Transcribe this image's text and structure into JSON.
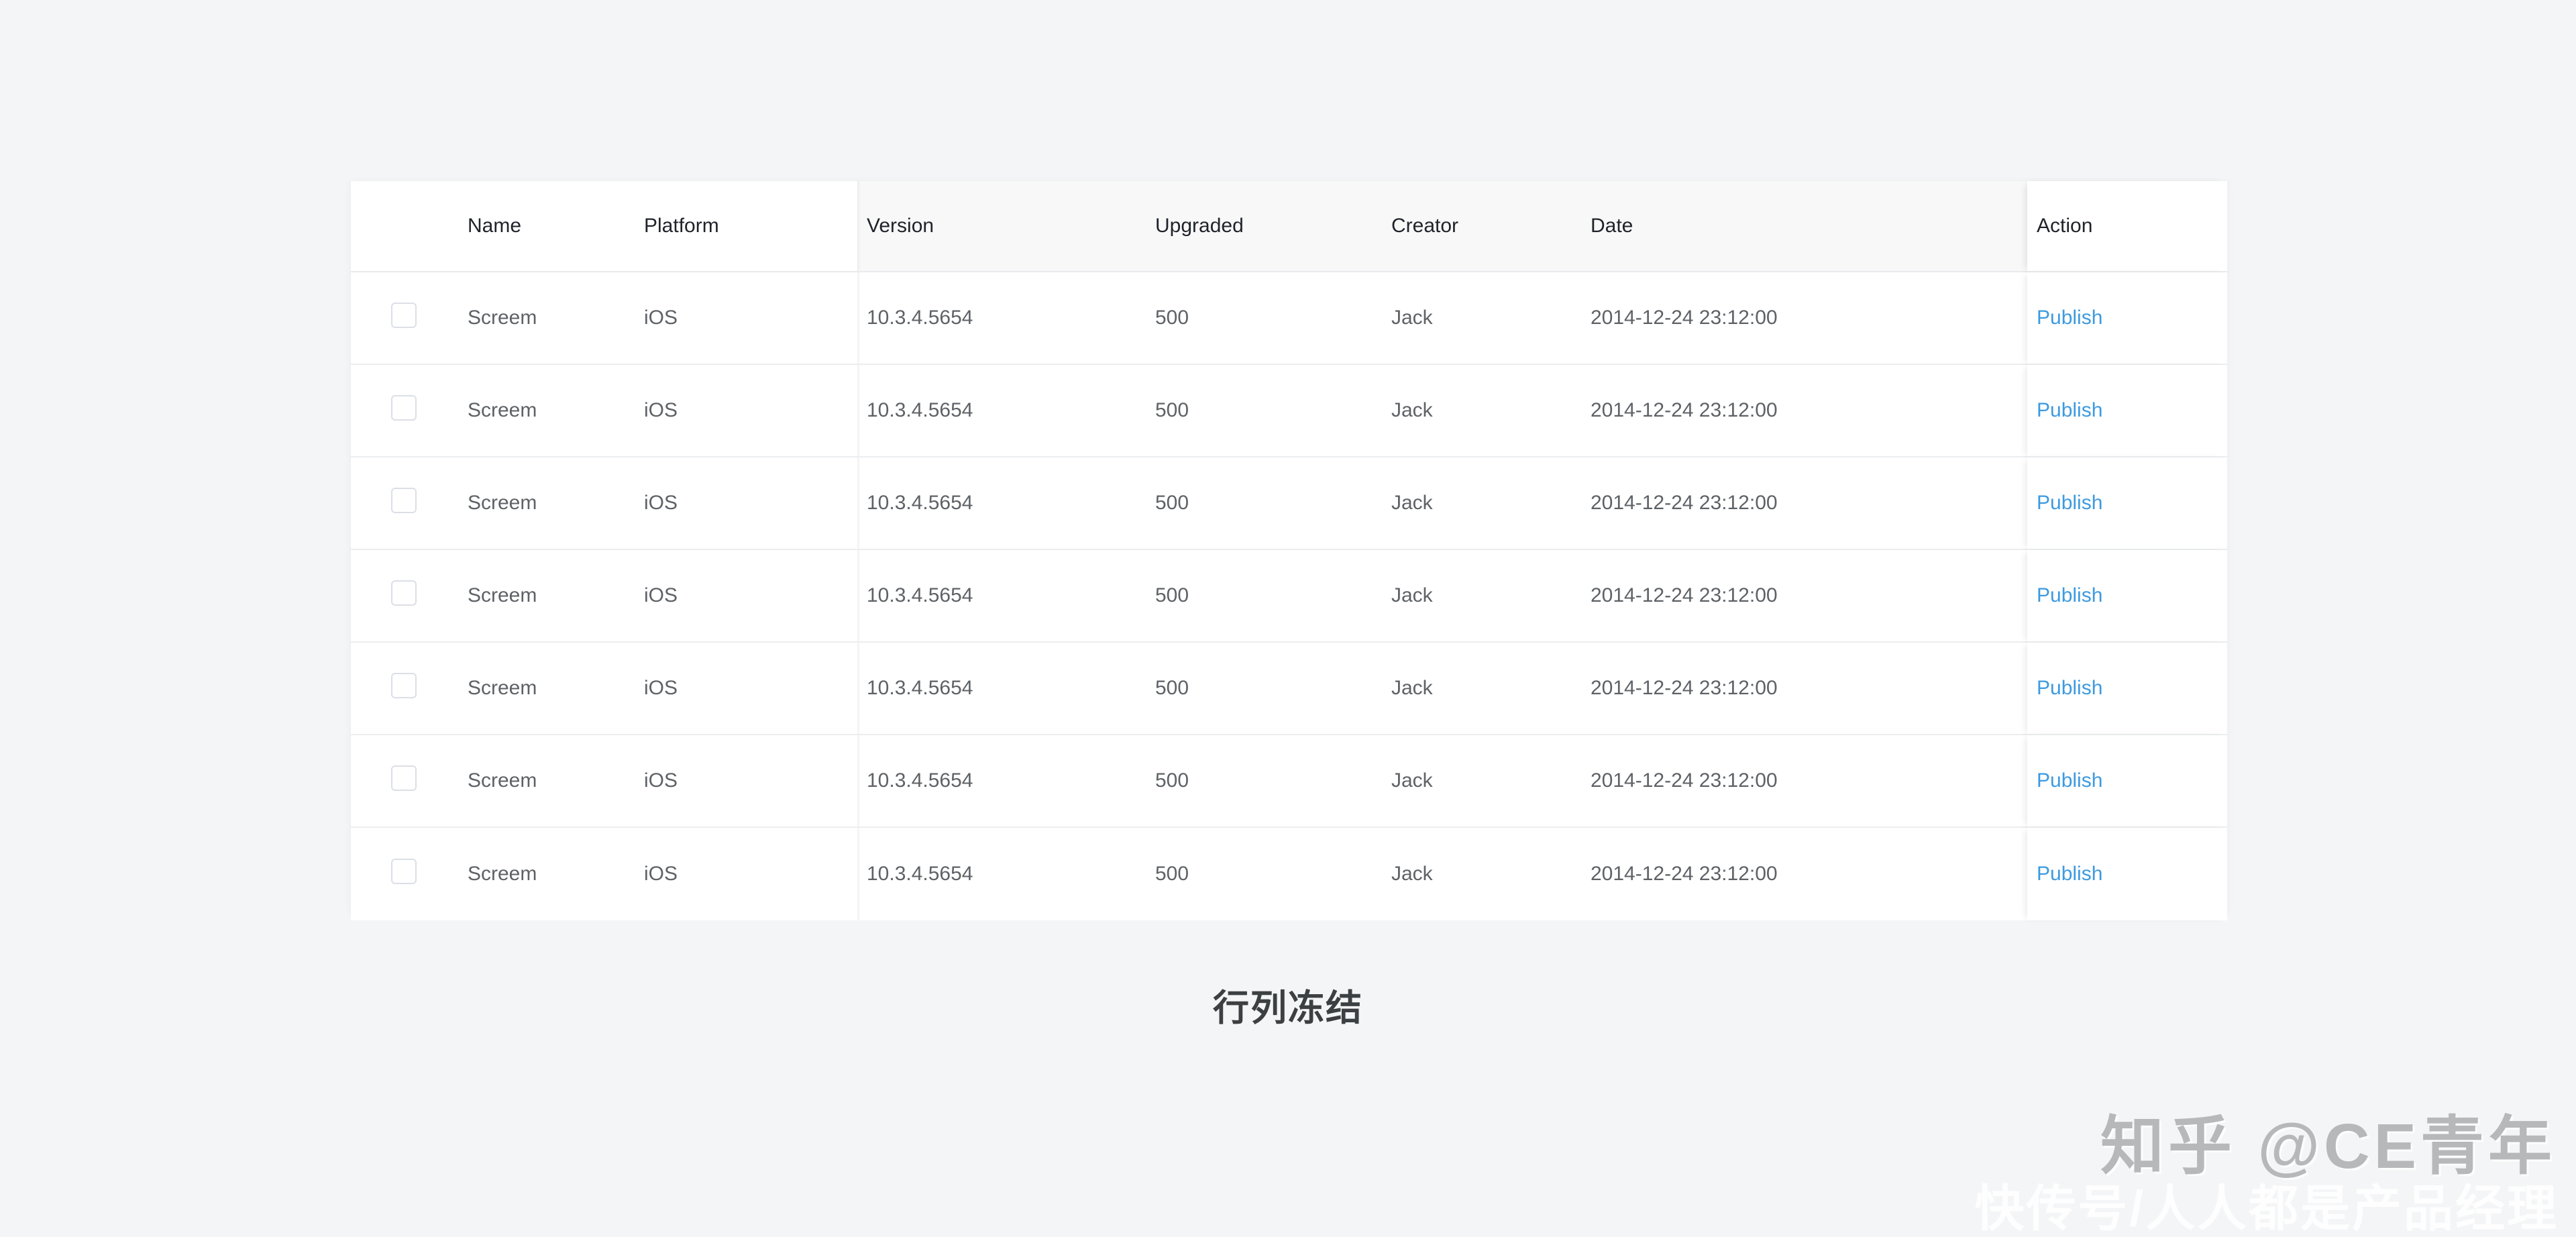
{
  "table": {
    "columns": [
      {
        "key": "checkbox",
        "label": "",
        "frozen": "left"
      },
      {
        "key": "name",
        "label": "Name",
        "frozen": "left"
      },
      {
        "key": "platform",
        "label": "Platform",
        "frozen": "left"
      },
      {
        "key": "version",
        "label": "Version",
        "frozen": "none"
      },
      {
        "key": "upgraded",
        "label": "Upgraded",
        "frozen": "none"
      },
      {
        "key": "creator",
        "label": "Creator",
        "frozen": "none"
      },
      {
        "key": "date",
        "label": "Date",
        "frozen": "none"
      },
      {
        "key": "action",
        "label": "Action",
        "frozen": "right"
      }
    ],
    "headers": {
      "name": "Name",
      "platform": "Platform",
      "version": "Version",
      "upgraded": "Upgraded",
      "creator": "Creator",
      "date": "Date",
      "action": "Action"
    },
    "rows": [
      {
        "name": "Screem",
        "platform": "iOS",
        "version": "10.3.4.5654",
        "upgraded": "500",
        "creator": "Jack",
        "date": "2014-12-24 23:12:00",
        "action": "Publish",
        "checked": false
      },
      {
        "name": "Screem",
        "platform": "iOS",
        "version": "10.3.4.5654",
        "upgraded": "500",
        "creator": "Jack",
        "date": "2014-12-24 23:12:00",
        "action": "Publish",
        "checked": false
      },
      {
        "name": "Screem",
        "platform": "iOS",
        "version": "10.3.4.5654",
        "upgraded": "500",
        "creator": "Jack",
        "date": "2014-12-24 23:12:00",
        "action": "Publish",
        "checked": false
      },
      {
        "name": "Screem",
        "platform": "iOS",
        "version": "10.3.4.5654",
        "upgraded": "500",
        "creator": "Jack",
        "date": "2014-12-24 23:12:00",
        "action": "Publish",
        "checked": false
      },
      {
        "name": "Screem",
        "platform": "iOS",
        "version": "10.3.4.5654",
        "upgraded": "500",
        "creator": "Jack",
        "date": "2014-12-24 23:12:00",
        "action": "Publish",
        "checked": false
      },
      {
        "name": "Screem",
        "platform": "iOS",
        "version": "10.3.4.5654",
        "upgraded": "500",
        "creator": "Jack",
        "date": "2014-12-24 23:12:00",
        "action": "Publish",
        "checked": false
      },
      {
        "name": "Screem",
        "platform": "iOS",
        "version": "10.3.4.5654",
        "upgraded": "500",
        "creator": "Jack",
        "date": "2014-12-24 23:12:00",
        "action": "Publish",
        "checked": false
      }
    ]
  },
  "caption": "行列冻结",
  "watermark": {
    "top": "知乎 @CE青年",
    "bottom": "快传号/人人都是产品经理"
  },
  "colors": {
    "page_background": "#f4f5f6",
    "table_background": "#ffffff",
    "header_background": "#f8f8f9",
    "link_blue": "#3d9ae0",
    "text_primary": "#1f2329",
    "text_secondary": "#5e6266",
    "border": "#ebedef",
    "caption_text": "#3c4043",
    "watermark_top": "#b6b8ba",
    "watermark_bottom": "#ffffff"
  }
}
